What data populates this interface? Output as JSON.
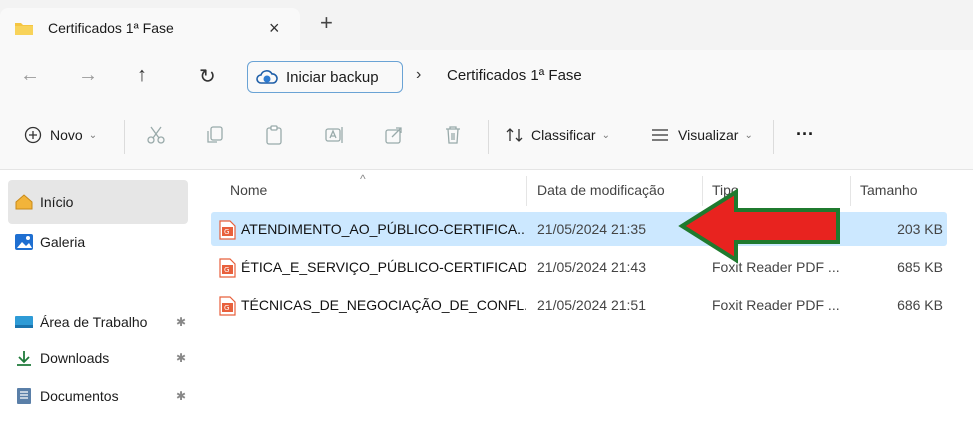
{
  "window": {
    "tab_title": "Certificados 1ª Fase",
    "close_glyph": "×",
    "new_tab_glyph": "+"
  },
  "address": {
    "back_glyph": "←",
    "forward_glyph": "→",
    "up_glyph": "↑",
    "refresh_glyph": "↻",
    "backup_label": "Iniciar backup",
    "separator": "›",
    "crumb": "Certificados 1ª Fase"
  },
  "toolbar": {
    "new_label": "Novo",
    "sort_label": "Classificar",
    "view_label": "Visualizar",
    "more_label": "···",
    "caret": "⌄"
  },
  "sidebar": {
    "items": [
      {
        "label": "Início",
        "icon": "home-icon",
        "selected": true
      },
      {
        "label": "Galeria",
        "icon": "gallery-icon"
      },
      {
        "label": "Área de Trabalho",
        "icon": "desktop-icon",
        "pinned": true
      },
      {
        "label": "Downloads",
        "icon": "download-icon",
        "pinned": true
      },
      {
        "label": "Documentos",
        "icon": "documents-icon",
        "pinned": true
      }
    ],
    "pin_glyph": "✱"
  },
  "list": {
    "columns": [
      "Nome",
      "Data de modificação",
      "Tipo",
      "Tamanho"
    ],
    "sort_glyph": "^",
    "rows": [
      {
        "name": "ATENDIMENTO_AO_PÚBLICO-CERTIFICA...",
        "date": "21/05/2024 21:35",
        "type": "Foxit Reader PDF ...",
        "size": "203 KB",
        "selected": true
      },
      {
        "name": "ÉTICA_E_SERVIÇO_PÚBLICO-CERTIFICAD...",
        "date": "21/05/2024 21:43",
        "type": "Foxit Reader PDF ...",
        "size": "685 KB"
      },
      {
        "name": "TÉCNICAS_DE_NEGOCIAÇÃO_DE_CONFL...",
        "date": "21/05/2024 21:51",
        "type": "Foxit Reader PDF ...",
        "size": "686 KB"
      }
    ]
  },
  "colors": {
    "selection": "#cce8ff",
    "arrow_fill": "#e8231f",
    "arrow_stroke": "#1f7a2e",
    "folder": "#f5c542",
    "pdf_icon": "#e8603c"
  }
}
